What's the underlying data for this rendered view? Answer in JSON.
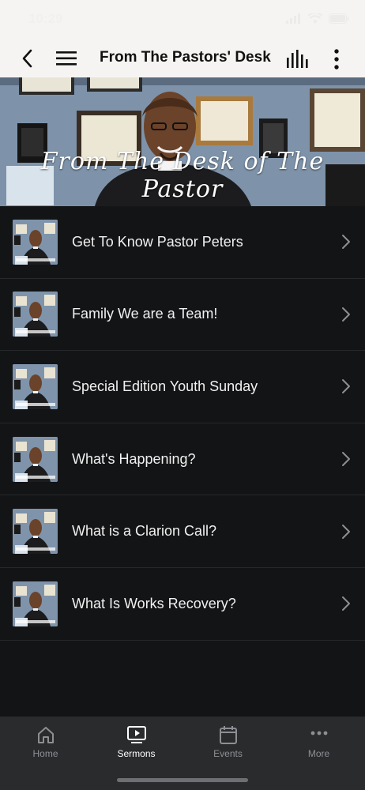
{
  "status_bar": {
    "time": "10:29"
  },
  "header": {
    "title": "From The Pastors' Desk",
    "back_icon": "chevron-left-icon",
    "menu_icon": "hamburger-icon",
    "audio_icon": "audio-bars-icon",
    "more_icon": "vertical-dots-icon"
  },
  "banner": {
    "caption": "From The Desk of The Pastor"
  },
  "sermons": [
    {
      "title": "Get To Know Pastor Peters"
    },
    {
      "title": "Family We are a Team!"
    },
    {
      "title": "Special Edition Youth Sunday"
    },
    {
      "title": "What's Happening?"
    },
    {
      "title": "What is a Clarion Call?"
    },
    {
      "title": "What Is Works Recovery?"
    }
  ],
  "bottom_nav": {
    "tabs": [
      {
        "label": "Home",
        "icon": "home-icon",
        "active": false
      },
      {
        "label": "Sermons",
        "icon": "play-screen-icon",
        "active": true
      },
      {
        "label": "Events",
        "icon": "calendar-icon",
        "active": false
      },
      {
        "label": "More",
        "icon": "more-dots-icon",
        "active": false
      }
    ]
  },
  "colors": {
    "background": "#131416",
    "header_bg": "#f6f4f2",
    "nav_bg": "#2a2b2d",
    "active_tab": "#ffffff",
    "inactive_tab": "#8d8f93"
  }
}
